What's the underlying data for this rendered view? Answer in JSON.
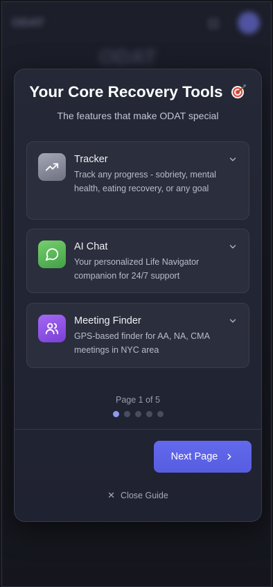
{
  "background": {
    "logo_text": "ODAT",
    "title_text": "ODAT"
  },
  "modal": {
    "title": "Your Core Recovery Tools",
    "title_icon": "target-icon",
    "subtitle": "The features that make ODAT special",
    "features": [
      {
        "title": "Tracker",
        "description": "Track any progress - sobriety, mental health, eating recovery, or any goal",
        "icon": "trend-up-icon",
        "color": "#8a8f9e"
      },
      {
        "title": "AI Chat",
        "description": "Your personalized Life Navigator companion for 24/7 support",
        "icon": "chat-bubble-icon",
        "color": "#5cb85c"
      },
      {
        "title": "Meeting Finder",
        "description": "GPS-based finder for AA, NA, CMA meetings in NYC area",
        "icon": "users-icon",
        "color": "#8e56e6"
      }
    ],
    "pager": {
      "text": "Page 1 of 5",
      "current": 1,
      "total": 5
    },
    "next_button_label": "Next Page",
    "close_label": "Close Guide"
  },
  "colors": {
    "accent": "#5f65e8",
    "dot_active": "#8c9af0",
    "dot_inactive": "#4a4d5e"
  }
}
